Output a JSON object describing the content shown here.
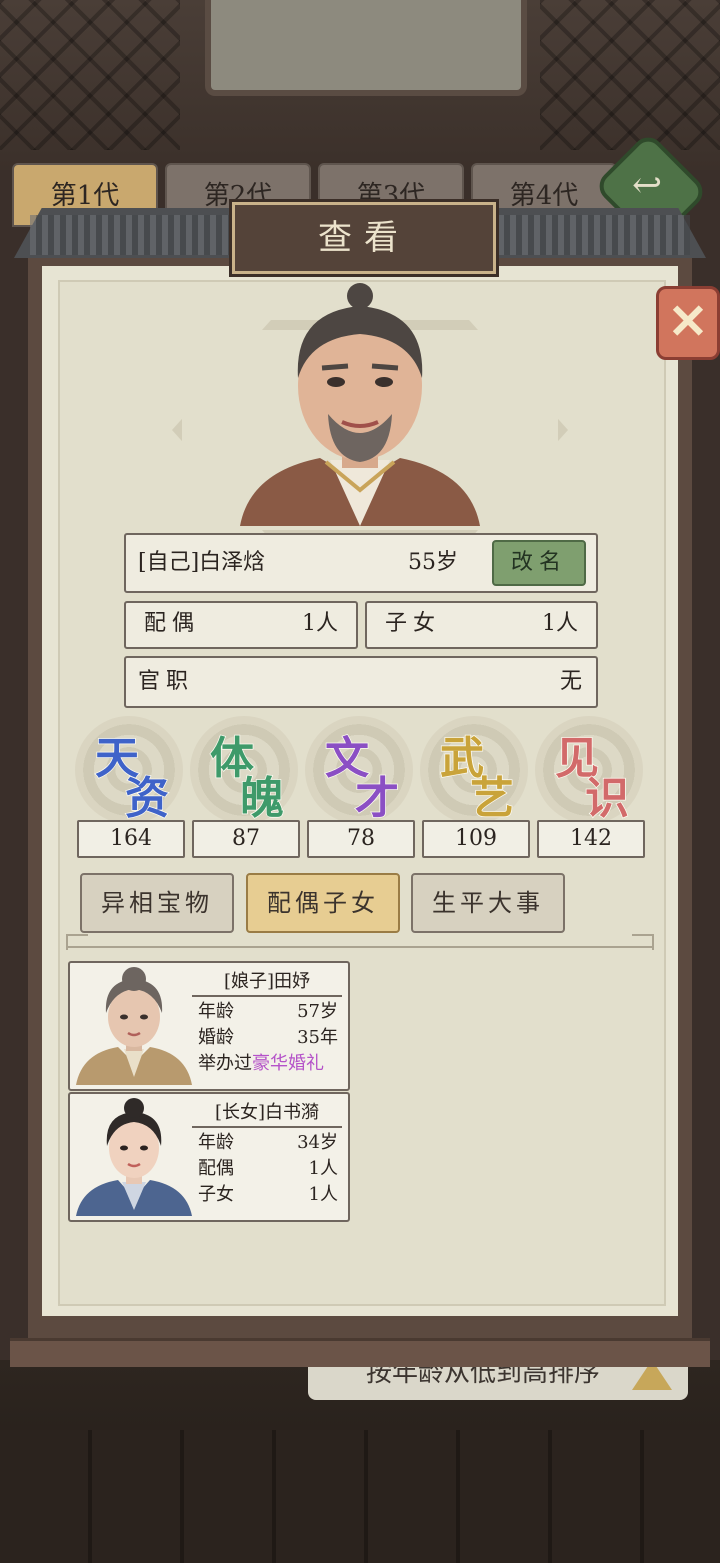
{
  "generation_tabs": [
    "第1代",
    "第2代",
    "第3代",
    "第4代"
  ],
  "dialog_title": "查看",
  "person": {
    "name": "[自己]白泽焓",
    "age": "55岁",
    "rename_label": "改名",
    "spouse_label": "配偶",
    "spouse_count": "1人",
    "children_label": "子女",
    "children_count": "1人",
    "office_label": "官职",
    "office_value": "无"
  },
  "stats": [
    {
      "c1": "天",
      "c2": "资",
      "value": "164",
      "color": "#3f63c9"
    },
    {
      "c1": "体",
      "c2": "魄",
      "value": "87",
      "color": "#3e9a6a"
    },
    {
      "c1": "文",
      "c2": "才",
      "value": "78",
      "color": "#8b4fc4"
    },
    {
      "c1": "武",
      "c2": "艺",
      "value": "109",
      "color": "#c9a33a"
    },
    {
      "c1": "见",
      "c2": "识",
      "value": "142",
      "color": "#d26a6a"
    }
  ],
  "section_tabs": [
    "异相宝物",
    "配偶子女",
    "生平大事"
  ],
  "active_section": 1,
  "family": [
    {
      "title": "[娘子]田妤",
      "rows": [
        {
          "label": "年龄",
          "value": "57岁"
        },
        {
          "label": "婚龄",
          "value": "35年"
        }
      ],
      "ceremony_label": "举办过",
      "ceremony_value": "豪华婚礼"
    },
    {
      "title": "[长女]白书漪",
      "rows": [
        {
          "label": "年龄",
          "value": "34岁"
        },
        {
          "label": "配偶",
          "value": "1人"
        },
        {
          "label": "子女",
          "value": "1人"
        }
      ]
    }
  ],
  "sort_label": "按年龄从低到高排序",
  "icons": [
    "back-arrow-icon",
    "close-icon",
    "sort-triangle-icon"
  ],
  "colors": {
    "accent_gold": "#e7cd92",
    "rename_green": "#7f9f6f",
    "highlight_purple": "#b553c9"
  }
}
